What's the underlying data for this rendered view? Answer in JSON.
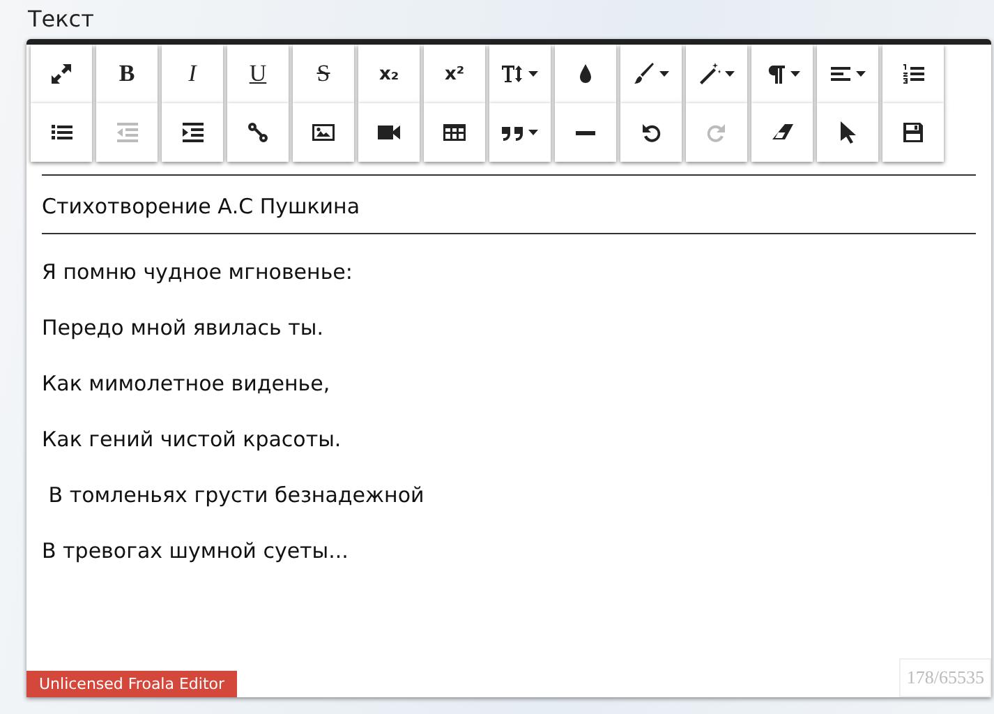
{
  "title": "Текст",
  "toolbar_rows": [
    [
      {
        "kind": "expand"
      },
      {
        "kind": "bold",
        "label": "B"
      },
      {
        "kind": "italic",
        "label": "I"
      },
      {
        "kind": "underline",
        "label": "U"
      },
      {
        "kind": "strike",
        "label": "S"
      },
      {
        "kind": "subscript",
        "label": "x₂"
      },
      {
        "kind": "superscript",
        "label": "x²"
      },
      {
        "kind": "fontsize",
        "dropdown": true
      },
      {
        "kind": "drop"
      },
      {
        "kind": "brush",
        "dropdown": true
      },
      {
        "kind": "wand",
        "dropdown": true
      },
      {
        "kind": "paragraph",
        "dropdown": true
      },
      {
        "kind": "align",
        "dropdown": true
      },
      {
        "kind": "numbered"
      }
    ],
    [
      {
        "kind": "bullets"
      },
      {
        "kind": "outdent",
        "disabled": true
      },
      {
        "kind": "indent",
        "disabled": false
      },
      {
        "kind": "link"
      },
      {
        "kind": "image"
      },
      {
        "kind": "video"
      },
      {
        "kind": "table"
      },
      {
        "kind": "quote",
        "dropdown": true
      },
      {
        "kind": "rule"
      },
      {
        "kind": "undo",
        "disabled": false
      },
      {
        "kind": "redo",
        "disabled": true
      },
      {
        "kind": "eraser"
      },
      {
        "kind": "pointer"
      },
      {
        "kind": "save"
      }
    ]
  ],
  "heading": "Стихотворение А.С Пушкина",
  "paragraphs": [
    "Я помню чудное мгновенье:",
    "Передо мной явилась ты.",
    "Как мимолетное виденье,",
    "Как гений чистой красоты.",
    " В томленьях грусти безнадежной",
    "В тревогах шумной суеты..."
  ],
  "license_badge": "Unlicensed Froala Editor",
  "char_counter": "178/65535"
}
